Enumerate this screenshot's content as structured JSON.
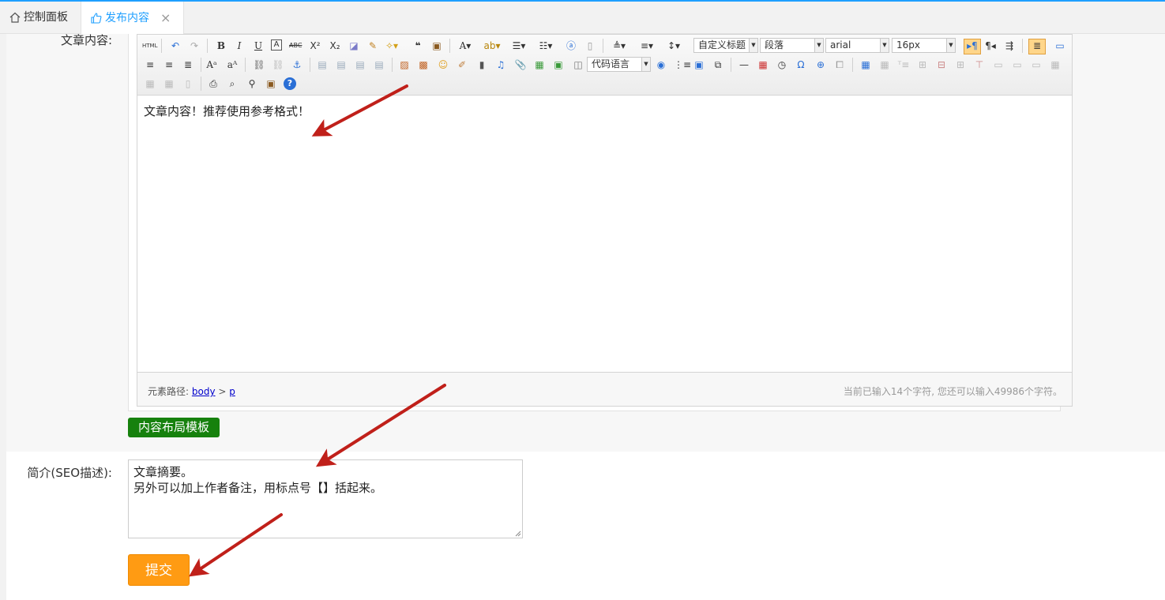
{
  "tabs": [
    {
      "label": "控制面板",
      "icon": "home-icon"
    },
    {
      "label": "发布内容",
      "icon": "thumb-up-icon",
      "close": "×"
    }
  ],
  "form": {
    "content_label": "文章内容:",
    "summary_label": "简介(SEO描述):",
    "layout_template_button": "内容布局模板",
    "summary_line1": "文章摘要。",
    "summary_line2": "另外可以加上作者备注，用标点号【】括起来。",
    "submit_label": "提交"
  },
  "editor": {
    "content_text": "文章内容！推荐使用参考格式！",
    "toolbar": {
      "html_label": "HTML",
      "heading_select": "自定义标题",
      "paragraph_select": "段落",
      "font_select": "arial",
      "size_select": "16px",
      "code_select": "代码语言"
    },
    "status": {
      "path_label": "元素路径:",
      "path_body": "body",
      "path_sep": ">",
      "path_p": "p",
      "counter": "当前已输入14个字符, 您还可以输入49986个字符。"
    }
  },
  "colors": {
    "accent": "#1e9fff",
    "green_button": "#16810d",
    "submit_button": "#ff9b13",
    "arrow": "#c0201a"
  }
}
